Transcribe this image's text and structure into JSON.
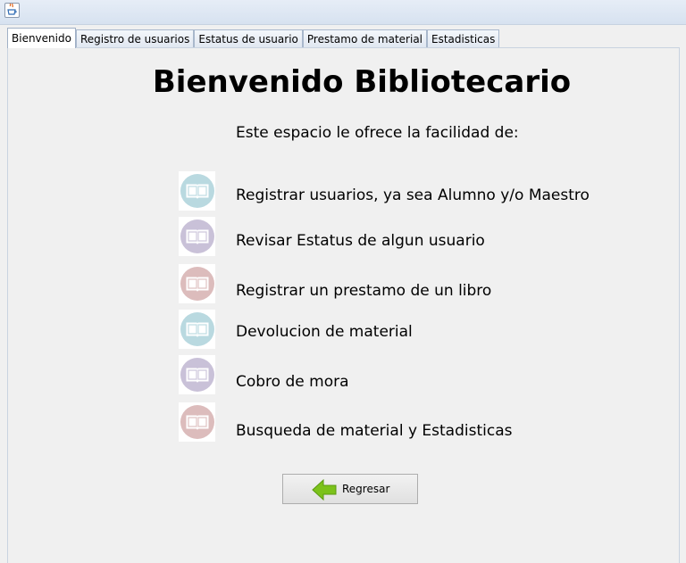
{
  "tabs": [
    {
      "label": "Bienvenido",
      "active": true
    },
    {
      "label": "Registro de usuarios",
      "active": false
    },
    {
      "label": "Estatus de usuario",
      "active": false
    },
    {
      "label": "Prestamo de material",
      "active": false
    },
    {
      "label": "Estadisticas",
      "active": false
    }
  ],
  "main": {
    "title": "Bienvenido Bibliotecario",
    "subtitle": "Este espacio le ofrece la facilidad de:",
    "features": [
      {
        "label": "Registrar usuarios, ya sea Alumno y/o Maestro",
        "color": "#b9d9e0",
        "icon": "book-icon"
      },
      {
        "label": "Revisar Estatus de algun usuario",
        "color": "#c9c1d8",
        "icon": "book-icon"
      },
      {
        "label": "Registrar un prestamo de un libro",
        "color": "#dcbcbc",
        "icon": "book-icon"
      },
      {
        "label": "Devolucion de material",
        "color": "#b9d9e0",
        "icon": "book-icon"
      },
      {
        "label": "Cobro de mora",
        "color": "#c9c1d8",
        "icon": "book-icon"
      },
      {
        "label": "Busqueda de material y Estadisticas",
        "color": "#dcbcbc",
        "icon": "book-icon"
      }
    ],
    "back_button": {
      "label": "Regresar",
      "icon": "arrow-left-icon",
      "icon_color": "#7cc21b"
    }
  }
}
